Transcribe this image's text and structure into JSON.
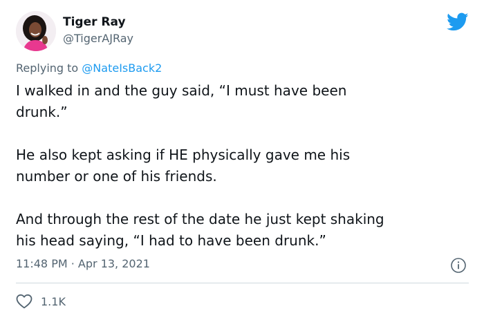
{
  "author": {
    "display_name": "Tiger Ray",
    "handle": "@TigerAJRay"
  },
  "reply": {
    "prefix": "Replying to ",
    "mention": "@NateIsBack2"
  },
  "body": {
    "paragraphs": [
      "I walked in and the guy said, “I must have been\ndrunk.”",
      "He also kept asking if HE physically gave me his\nnumber or one of his friends.",
      "And through the rest of the date he just kept shaking\nhis head saying, “I had to have been drunk.”"
    ]
  },
  "meta": {
    "time": "11:48 PM",
    "separator": " · ",
    "date": "Apr 13, 2021"
  },
  "stats": {
    "likes": "1.1K"
  },
  "icons": {
    "brand": "twitter-bird-icon",
    "info": "info-icon",
    "like": "heart-icon"
  },
  "colors": {
    "brand_blue": "#1d9bf0",
    "text_primary": "#0f1419",
    "text_secondary": "#536471",
    "divider": "#cfd9de",
    "avatar_outfit": "#e8388f"
  }
}
